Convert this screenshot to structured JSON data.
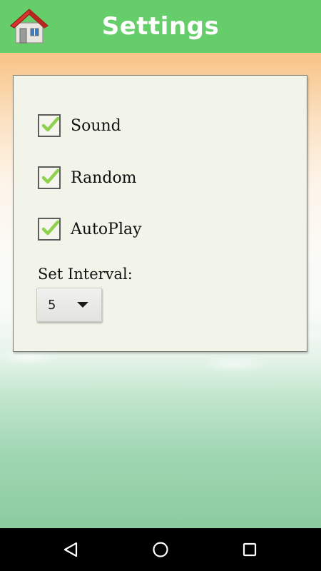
{
  "header": {
    "title": "Settings",
    "home_icon": "home-icon",
    "bar_color": "#65cd69"
  },
  "options": [
    {
      "label": "Sound",
      "checked": true
    },
    {
      "label": "Random",
      "checked": true
    },
    {
      "label": "AutoPlay",
      "checked": true
    }
  ],
  "interval": {
    "label": "Set Interval:",
    "selected": "5"
  },
  "navbar": {
    "back_icon": "back-triangle-icon",
    "home_icon": "home-circle-icon",
    "recents_icon": "recents-square-icon"
  },
  "colors": {
    "check_mark": "#8fd14f",
    "card_bg": "#f3f4e9"
  }
}
